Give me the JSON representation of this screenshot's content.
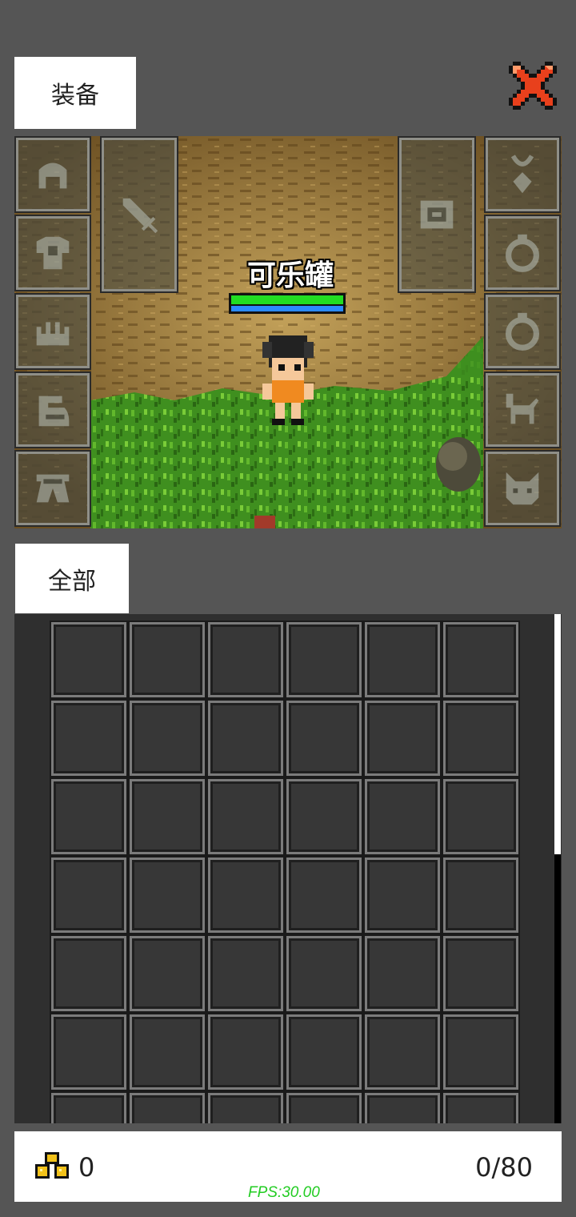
{
  "header": {
    "equip_tab_label": "装备",
    "close_icon": "close-x-icon"
  },
  "scene": {
    "player_name": "可乐罐",
    "hp_fraction": 1.0,
    "mp_fraction": 1.0,
    "left_slots": [
      "helmet-icon",
      "armor-icon",
      "gloves-icon",
      "boots-icon",
      "pants-icon"
    ],
    "weapon_slot_icon": "sword-icon",
    "offhand_slot_icon": "shield-icon",
    "right_slots": [
      "amulet-icon",
      "ring-icon",
      "ring-icon",
      "mount-icon",
      "pet-icon"
    ]
  },
  "inventory": {
    "filter_tab_label": "全部",
    "visible_rows": 7,
    "columns": 6
  },
  "footer": {
    "gold_icon": "gold-coins-icon",
    "gold_value": "0",
    "capacity": "0/80",
    "fps": "FPS:30.00"
  },
  "colors": {
    "hp": "#22dd22",
    "mp": "#2a8aff",
    "close_icon": "#e8401c",
    "fps_text": "#22cc22"
  }
}
